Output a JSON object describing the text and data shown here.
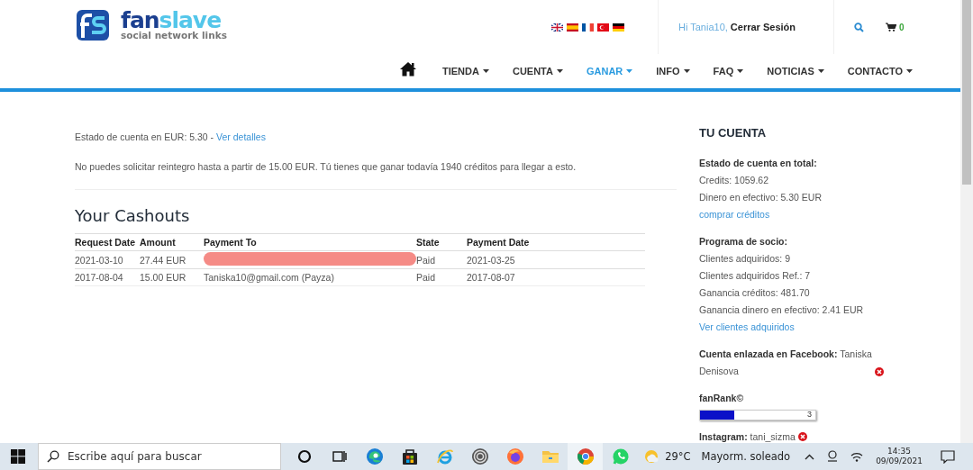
{
  "header": {
    "logo": {
      "brand_a": "fan",
      "brand_b": "slave",
      "tagline": "social network links"
    },
    "greeting": "Hi Tania10,",
    "logout": "Cerrar Sesión",
    "cart_count": "0",
    "nav": [
      {
        "label": "TIENDA",
        "selected": false
      },
      {
        "label": "CUENTA",
        "selected": false
      },
      {
        "label": "GANAR",
        "selected": true
      },
      {
        "label": "INFO",
        "selected": false
      },
      {
        "label": "FAQ",
        "selected": false
      },
      {
        "label": "NOTICIAS",
        "selected": false
      },
      {
        "label": "CONTACTO",
        "selected": false
      }
    ]
  },
  "main": {
    "balance_text": "Estado de cuenta en EUR: 5.30 -",
    "balance_link": "Ver detalles",
    "notice": "No puedes solicitar reintegro hasta a partir de 15.00 EUR. Tú tienes que ganar todavía 1940 créditos para llegar a esto.",
    "cashouts": {
      "title": "Your Cashouts",
      "columns": [
        "Request Date",
        "Amount",
        "Payment To",
        "State",
        "Payment Date"
      ],
      "rows": [
        {
          "request_date": "2021-03-10",
          "amount": "27.44 EUR",
          "payment_to": "",
          "redacted": true,
          "state": "Paid",
          "payment_date": "2021-03-25"
        },
        {
          "request_date": "2017-08-04",
          "amount": "15.00 EUR",
          "payment_to": "Taniska10@gmail.com (Payza)",
          "redacted": false,
          "state": "Paid",
          "payment_date": "2017-08-07"
        }
      ]
    }
  },
  "sidebar": {
    "title": "TU CUENTA",
    "sections": [
      {
        "heading": "Estado de cuenta en total:",
        "lines": [
          {
            "kind": "text",
            "text": "Credits: 1059.62"
          },
          {
            "kind": "text",
            "text": "Dinero en efectivo: 5.30 EUR"
          },
          {
            "kind": "link",
            "text": "comprar créditos"
          }
        ]
      },
      {
        "heading": "Programa de socio:",
        "lines": [
          {
            "kind": "text",
            "text": "Clientes adquiridos: 9"
          },
          {
            "kind": "text",
            "text": "Clientes adquiridos Ref.: 7"
          },
          {
            "kind": "text",
            "text": "Ganancia créditos: 481.70"
          },
          {
            "kind": "text",
            "text": "Ganancia dinero en efectivo: 2.41 EUR"
          },
          {
            "kind": "link",
            "text": "Ver clientes adquiridos"
          }
        ]
      }
    ],
    "facebook": "**Cuenta enlazada en Facebook:** Taniska Denisova",
    "fanrank": {
      "label": "fanRank©",
      "level": 0.3,
      "reading": "3"
    },
    "instagram": "**Instagram:** tani_sizma"
  },
  "taskbar": {
    "search_placeholder": "Escribe aquí para buscar",
    "apps": [
      {
        "kind": "cortana",
        "selected": false
      },
      {
        "kind": "taskview",
        "selected": false
      },
      {
        "kind": "edge",
        "selected": false
      },
      {
        "kind": "store",
        "selected": false
      },
      {
        "kind": "ie",
        "selected": false
      },
      {
        "kind": "spiral",
        "selected": false
      },
      {
        "kind": "firefox",
        "selected": false
      },
      {
        "kind": "folder",
        "selected": false
      },
      {
        "kind": "chrome",
        "selected": true
      },
      {
        "kind": "whatsapp",
        "selected": false
      }
    ],
    "temperature": "29°C",
    "weather": "Mayorm. soleado",
    "time": "14:35",
    "date": "09/09/2021"
  }
}
